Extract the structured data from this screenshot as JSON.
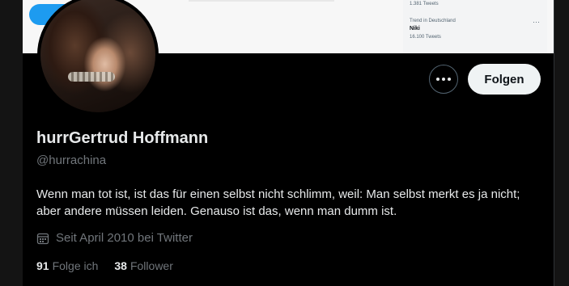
{
  "trends": {
    "top_count": "1.381 Tweets",
    "context": "Trend in Deutschland",
    "name": "Niki",
    "count": "16.100 Tweets",
    "more": "···"
  },
  "actions": {
    "follow_label": "Folgen",
    "more_icon": "more-icon"
  },
  "profile": {
    "name": "hurrGertrud Hoffmann",
    "handle": "@hurrachina",
    "bio": "Wenn man tot ist, ist das für einen selbst nicht schlimm, weil: Man selbst merkt es ja nicht; aber andere müssen leiden. Genauso ist das, wenn man dumm ist.",
    "joined": "Seit April 2010 bei Twitter",
    "joined_icon": "calendar-icon"
  },
  "stats": {
    "following_count": "91",
    "following_label": "Folge ich",
    "followers_count": "38",
    "followers_label": "Follower"
  },
  "colors": {
    "background": "#000000",
    "text": "#e7e9ea",
    "muted": "#71767b",
    "follow_button_bg": "#eff3f4",
    "accent_blue": "#1d9bf0"
  }
}
